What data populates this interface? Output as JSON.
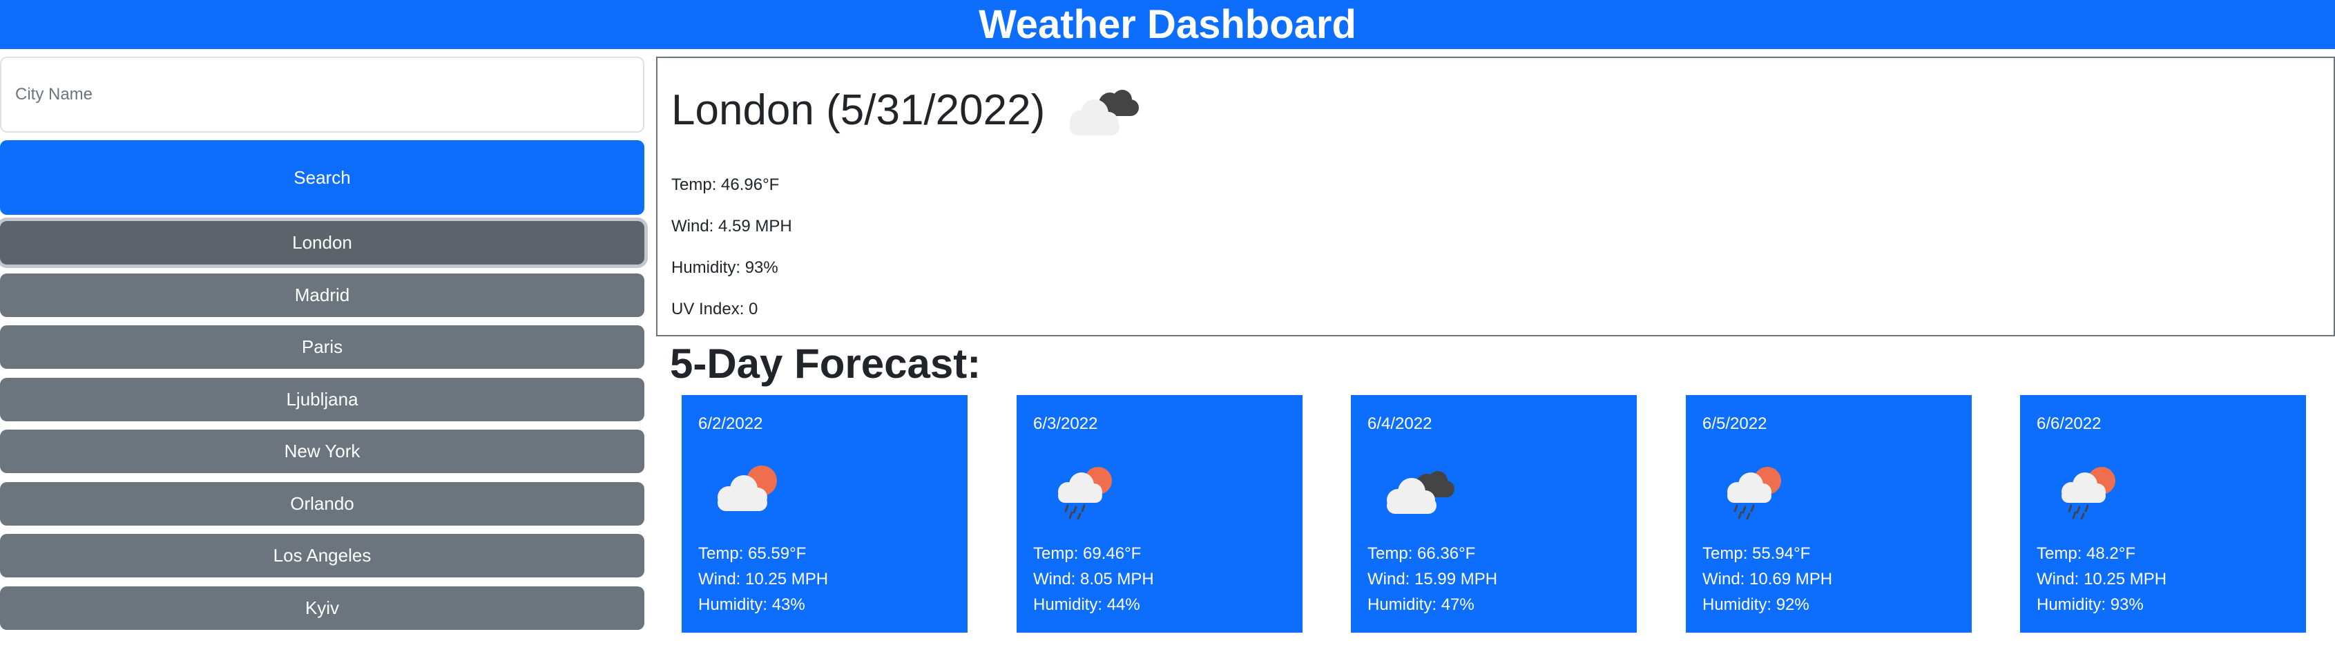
{
  "header": {
    "title": "Weather Dashboard"
  },
  "search": {
    "placeholder": "City Name",
    "button_label": "Search"
  },
  "history": [
    "London",
    "Madrid",
    "Paris",
    "Ljubljana",
    "New York",
    "Orlando",
    "Los Angeles",
    "Kyiv"
  ],
  "current": {
    "title": "London (5/31/2022)",
    "icon": "broken-clouds-icon",
    "temp": "Temp: 46.96°F",
    "wind": "Wind: 4.59 MPH",
    "humidity": "Humidity: 93%",
    "uv": "UV Index: 0"
  },
  "forecast_title": "5-Day Forecast:",
  "forecast": [
    {
      "date": "6/2/2022",
      "icon": "partly-cloudy-icon",
      "temp": "Temp: 65.59°F",
      "wind": "Wind: 10.25 MPH",
      "humidity": "Humidity: 43%"
    },
    {
      "date": "6/3/2022",
      "icon": "rain-icon",
      "temp": "Temp: 69.46°F",
      "wind": "Wind: 8.05 MPH",
      "humidity": "Humidity: 44%"
    },
    {
      "date": "6/4/2022",
      "icon": "broken-clouds-icon",
      "temp": "Temp: 66.36°F",
      "wind": "Wind: 15.99 MPH",
      "humidity": "Humidity: 47%"
    },
    {
      "date": "6/5/2022",
      "icon": "rain-icon",
      "temp": "Temp: 55.94°F",
      "wind": "Wind: 10.69 MPH",
      "humidity": "Humidity: 92%"
    },
    {
      "date": "6/6/2022",
      "icon": "rain-icon",
      "temp": "Temp: 48.2°F",
      "wind": "Wind: 10.25 MPH",
      "humidity": "Humidity: 93%"
    }
  ],
  "colors": {
    "primary": "#0d6efd",
    "secondary": "#6c757d",
    "sun": "#ee6e4e",
    "cloud_light": "#f0f0f0",
    "cloud_dark": "#444444"
  }
}
